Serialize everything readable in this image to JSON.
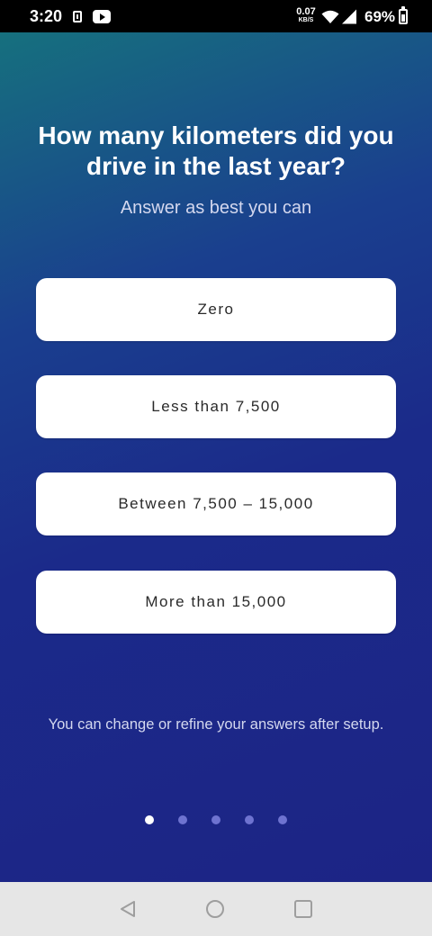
{
  "status_bar": {
    "time": "3:20",
    "net_speed_value": "0.07",
    "net_speed_unit": "KB/S",
    "battery_percent": "69%",
    "battery_level": 0.69,
    "icons": [
      "sim-icon",
      "youtube-icon",
      "wifi-icon",
      "signal-icon",
      "battery-icon"
    ]
  },
  "question": {
    "title": "How many kilometers did you drive in the last year?",
    "subtitle": "Answer as best you can"
  },
  "options": [
    {
      "label": "Zero"
    },
    {
      "label": "Less than 7,500"
    },
    {
      "label": "Between 7,500 – 15,000"
    },
    {
      "label": "More than 15,000"
    }
  ],
  "footer_note": "You can change or refine your answers after setup.",
  "pagination": {
    "total": 5,
    "current": 1
  },
  "nav_bar": {
    "icons": [
      "back-icon",
      "home-icon",
      "recents-icon"
    ]
  },
  "colors": {
    "gradient_top": "#16707e",
    "gradient_bottom": "#1c2485",
    "option_background": "#ffffff",
    "option_text": "#2a2a2a",
    "dot_active": "#ffffff",
    "dot_inactive": "#6e73d0",
    "nav_bar_background": "#e6e6e6"
  }
}
